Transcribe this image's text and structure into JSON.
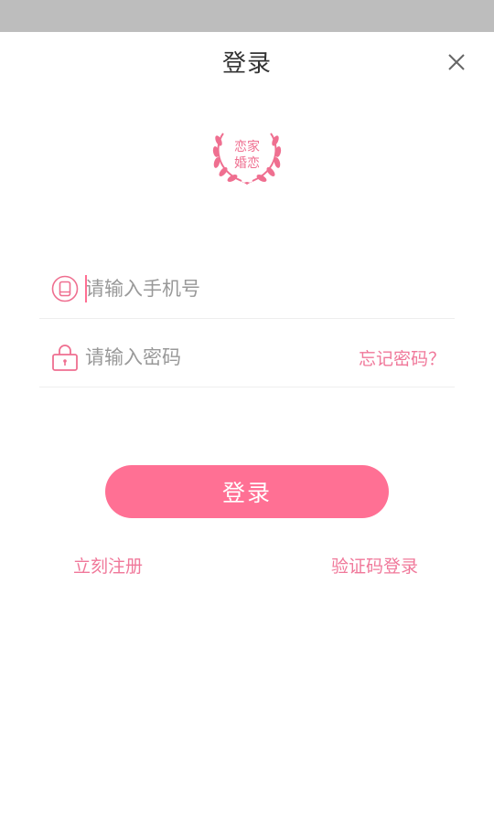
{
  "header": {
    "title": "登录",
    "close_icon": "close-icon"
  },
  "logo": {
    "line1": "恋家",
    "line2": "婚恋",
    "icon": "laurel-wreath-logo"
  },
  "form": {
    "phone": {
      "placeholder": "请输入手机号",
      "value": "",
      "icon": "phone-icon"
    },
    "password": {
      "placeholder": "请输入密码",
      "value": "",
      "icon": "lock-icon"
    },
    "forgot_label": "忘记密码？"
  },
  "actions": {
    "login_label": "登录",
    "register_label": "立刻注册",
    "sms_login_label": "验证码登录"
  },
  "colors": {
    "accent": "#ff7094",
    "link": "#f0789a",
    "status_bar": "#bdbdbd"
  }
}
